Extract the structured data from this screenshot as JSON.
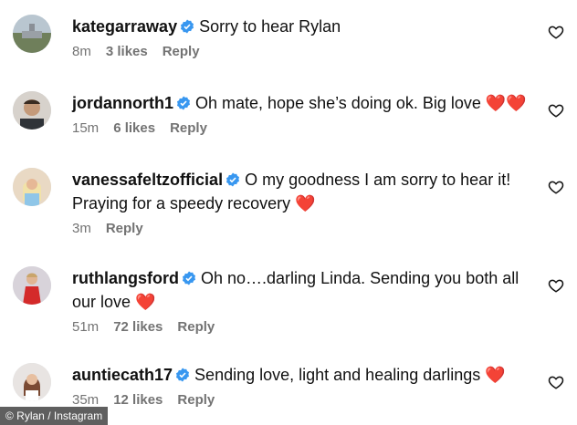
{
  "comments": [
    {
      "username": "kategarraway",
      "text": "Sorry to hear Rylan",
      "time": "8m",
      "likes": "3 likes",
      "reply": "Reply"
    },
    {
      "username": "jordannorth1",
      "text": "Oh mate, hope she’s doing ok. Big love ❤️❤️",
      "time": "15m",
      "likes": "6 likes",
      "reply": "Reply"
    },
    {
      "username": "vanessafeltzofficial",
      "text_line1": "O my goodness I am sorry to hear it!",
      "text_line2": "Praying for a speedy recovery ❤️",
      "time": "3m",
      "reply": "Reply"
    },
    {
      "username": "ruthlangsford",
      "text_line1": "Oh no….darling Linda. Sending you both all",
      "text_line2": "our love ❤️",
      "time": "51m",
      "likes": "72 likes",
      "reply": "Reply"
    },
    {
      "username": "auntiecath17",
      "text": "Sending love, light and healing darlings ❤️",
      "time": "35m",
      "likes": "12 likes",
      "reply": "Reply"
    }
  ],
  "credit": "© Rylan / Instagram",
  "colors": {
    "verified": "#3897f0",
    "muted": "#737373",
    "text": "#111111"
  },
  "icons": {
    "verified": "verified-badge-icon",
    "like": "heart-outline-icon"
  }
}
